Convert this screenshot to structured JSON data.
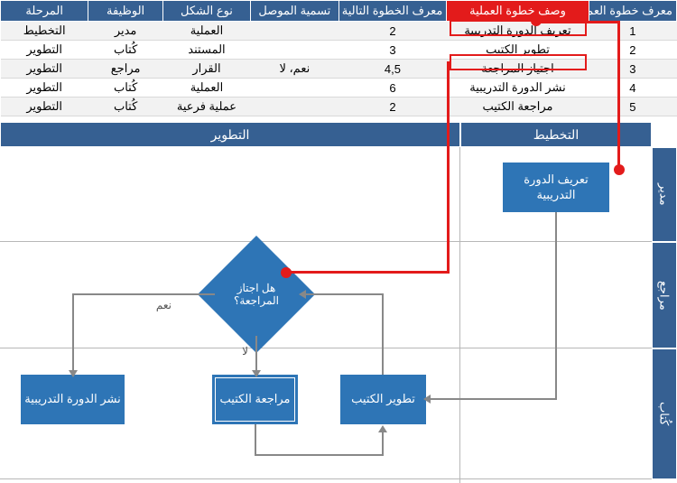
{
  "table": {
    "headers": [
      "معرف خطوة العملية",
      "وصف خطوة العملية",
      "معرف الخطوة التالية",
      "تسمية الموصل",
      "نوع الشكل",
      "الوظيفة",
      "المرحلة"
    ],
    "rows": [
      [
        "1",
        "تعريف الدورة التدريبية",
        "2",
        "",
        "العملية",
        "مدير",
        "التخطيط"
      ],
      [
        "2",
        "تطوير الكتيب",
        "3",
        "",
        "المستند",
        "كُتاب",
        "التطوير"
      ],
      [
        "3",
        "اجتياز المراجعة",
        "4,5",
        "نعم، لا",
        "القرار",
        "مراجع",
        "التطوير"
      ],
      [
        "4",
        "نشر الدورة التدريبية",
        "6",
        "",
        "العملية",
        "كُتاب",
        "التطوير"
      ],
      [
        "5",
        "مراجعة الكتيب",
        "2",
        "",
        "عملية فرعية",
        "كُتاب",
        "التطوير"
      ]
    ]
  },
  "phases": {
    "p1": "التخطيط",
    "p2": "التطوير"
  },
  "lanes": {
    "l1": "مدير",
    "l2": "مراجع",
    "l3": "كُتاب"
  },
  "nodes": {
    "n1": "تعريف الدورة التدريبية",
    "n2": "تطوير الكتيب",
    "n3": "هل اجتاز المراجعة؟",
    "n4": "نشر الدورة التدريبية",
    "n5": "مراجعة الكتيب"
  },
  "edges": {
    "yes": "نعم",
    "no": "لا"
  },
  "chart_data": {
    "type": "diagram",
    "phases": [
      "التخطيط",
      "التطوير"
    ],
    "swimlanes": [
      "مدير",
      "مراجع",
      "كُتاب"
    ],
    "nodes": [
      {
        "id": 1,
        "label": "تعريف الدورة التدريبية",
        "shape": "process",
        "lane": "مدير",
        "phase": "التخطيط"
      },
      {
        "id": 2,
        "label": "تطوير الكتيب",
        "shape": "document",
        "lane": "كُتاب",
        "phase": "التطوير"
      },
      {
        "id": 3,
        "label": "هل اجتاز المراجعة؟",
        "shape": "decision",
        "lane": "مراجع",
        "phase": "التطوير"
      },
      {
        "id": 4,
        "label": "نشر الدورة التدريبية",
        "shape": "process",
        "lane": "كُتاب",
        "phase": "التطوير"
      },
      {
        "id": 5,
        "label": "مراجعة الكتيب",
        "shape": "subprocess",
        "lane": "كُتاب",
        "phase": "التطوير"
      }
    ],
    "edges": [
      {
        "from": 1,
        "to": 2,
        "label": ""
      },
      {
        "from": 2,
        "to": 3,
        "label": ""
      },
      {
        "from": 3,
        "to": 4,
        "label": "نعم"
      },
      {
        "from": 3,
        "to": 5,
        "label": "لا"
      },
      {
        "from": 5,
        "to": 2,
        "label": ""
      }
    ],
    "annotations": [
      {
        "type": "highlight-column",
        "column": "وصف خطوة العملية"
      },
      {
        "type": "link",
        "from_row": 1,
        "to_node": 1
      },
      {
        "type": "link",
        "from_row": 3,
        "to_node": 3
      }
    ]
  }
}
